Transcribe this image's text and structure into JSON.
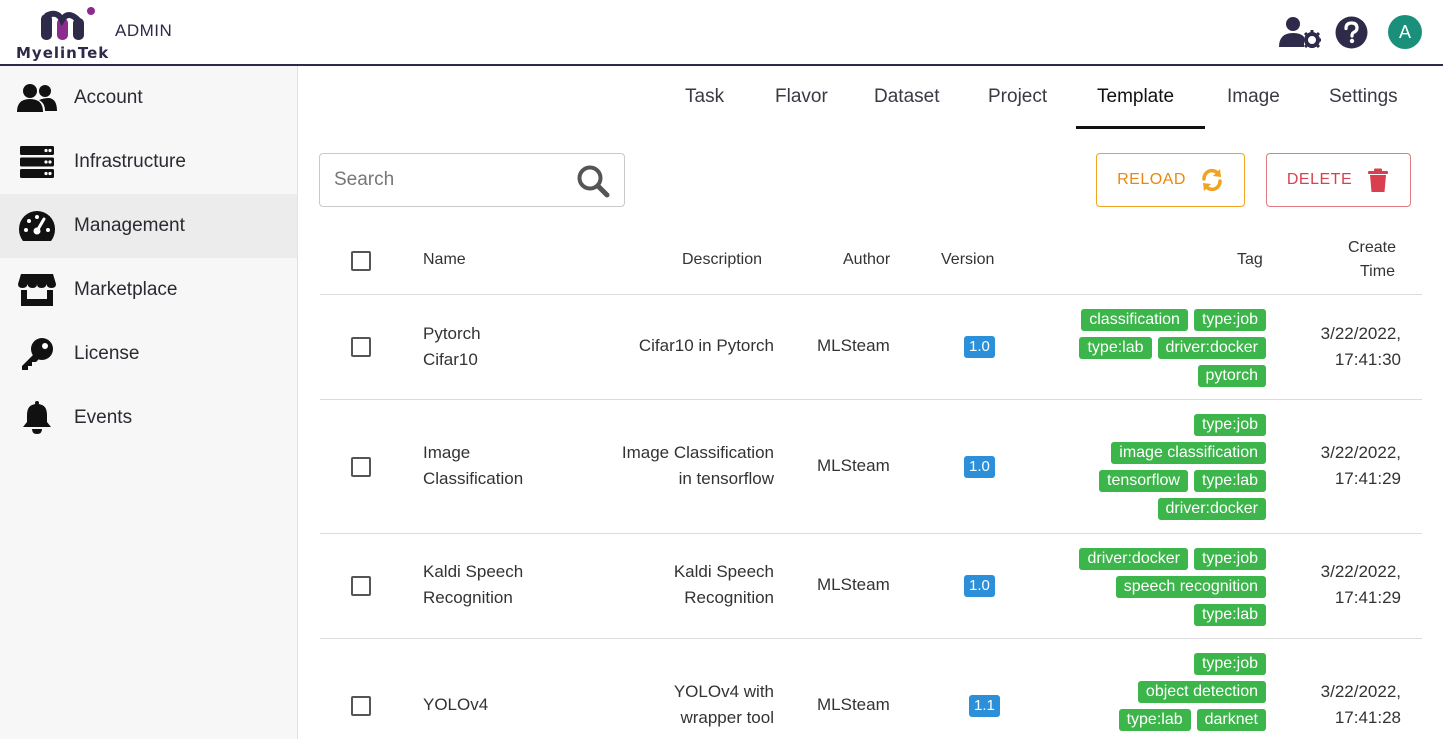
{
  "header": {
    "logo_text": "MyelinTek",
    "admin_label": "ADMIN",
    "avatar_letter": "A",
    "icons": [
      "user-gear-icon",
      "help-icon"
    ]
  },
  "sidebar": {
    "items": [
      {
        "label": "Account",
        "icon": "users-icon"
      },
      {
        "label": "Infrastructure",
        "icon": "server-icon"
      },
      {
        "label": "Management",
        "icon": "gauge-icon",
        "active": true
      },
      {
        "label": "Marketplace",
        "icon": "store-icon"
      },
      {
        "label": "License",
        "icon": "key-icon"
      },
      {
        "label": "Events",
        "icon": "bell-icon"
      }
    ]
  },
  "tabs": [
    {
      "label": "Task"
    },
    {
      "label": "Flavor"
    },
    {
      "label": "Dataset"
    },
    {
      "label": "Project"
    },
    {
      "label": "Template",
      "active": true
    },
    {
      "label": "Image"
    },
    {
      "label": "Settings"
    }
  ],
  "toolbar": {
    "search_placeholder": "Search",
    "reload_label": "RELOAD",
    "delete_label": "DELETE",
    "colors": {
      "reload": "#f0a321",
      "delete": "#d9404f"
    }
  },
  "table": {
    "headers": {
      "name": "Name",
      "description": "Description",
      "author": "Author",
      "version": "Version",
      "tag": "Tag",
      "create_time_1": "Create",
      "create_time_2": "Time"
    },
    "rows": [
      {
        "name_1": "Pytorch",
        "name_2": "Cifar10",
        "desc_1": "Cifar10 in Pytorch",
        "desc_2": "",
        "author": "MLSteam",
        "version": "1.0",
        "tags": [
          [
            "classification",
            "type:job"
          ],
          [
            "type:lab",
            "driver:docker"
          ],
          [
            "pytorch"
          ]
        ],
        "time_1": "3/22/2022,",
        "time_2": "17:41:30"
      },
      {
        "name_1": "Image",
        "name_2": "Classification",
        "desc_1": "Image Classification",
        "desc_2": "in tensorflow",
        "author": "MLSteam",
        "version": "1.0",
        "tags": [
          [
            "type:job"
          ],
          [
            "image classification"
          ],
          [
            "tensorflow",
            "type:lab"
          ],
          [
            "driver:docker"
          ]
        ],
        "time_1": "3/22/2022,",
        "time_2": "17:41:29"
      },
      {
        "name_1": "Kaldi Speech",
        "name_2": "Recognition",
        "desc_1": "Kaldi Speech",
        "desc_2": "Recognition",
        "author": "MLSteam",
        "version": "1.0",
        "tags": [
          [
            "driver:docker",
            "type:job"
          ],
          [
            "speech recognition"
          ],
          [
            "type:lab"
          ]
        ],
        "time_1": "3/22/2022,",
        "time_2": "17:41:29"
      },
      {
        "name_1": "YOLOv4",
        "name_2": "",
        "desc_1": "YOLOv4 with",
        "desc_2": "wrapper tool",
        "author": "MLSteam",
        "version": "1.1",
        "tags": [
          [
            "type:job"
          ],
          [
            "object detection"
          ],
          [
            "type:lab",
            "darknet"
          ]
        ],
        "time_1": "3/22/2022,",
        "time_2": "17:41:28"
      }
    ]
  }
}
